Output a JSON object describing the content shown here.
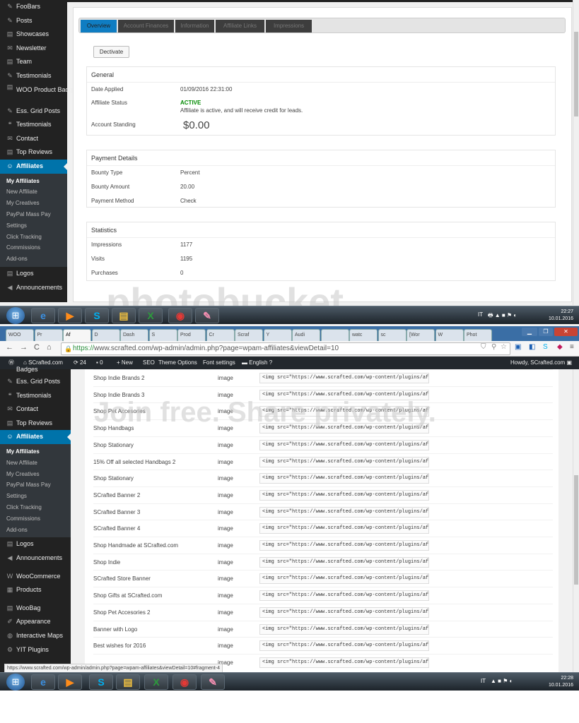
{
  "shot1": {
    "sidebar": [
      {
        "label": "FooBars",
        "icon": "pin-icon"
      },
      {
        "label": "Posts",
        "icon": "pin-icon"
      },
      {
        "label": "Showcases",
        "icon": "media-icon"
      },
      {
        "label": "Newsletter",
        "icon": "email-icon"
      },
      {
        "label": "Team",
        "icon": "media-icon"
      },
      {
        "label": "Testimonials",
        "icon": "pin-icon"
      },
      {
        "label": "WOO Product Badges",
        "icon": "media-icon",
        "two": true
      },
      {
        "label": "Ess. Grid Posts",
        "icon": "pin-icon"
      },
      {
        "label": "Testimonials",
        "icon": "quote-icon"
      },
      {
        "label": "Contact",
        "icon": "email-icon"
      },
      {
        "label": "Top Reviews",
        "icon": "media-icon"
      },
      {
        "label": "Affiliates",
        "icon": "users-icon",
        "active": true
      }
    ],
    "submenu": [
      "My Affiliates",
      "New Affiliate",
      "My Creatives",
      "PayPal Mass Pay",
      "Settings",
      "Click Tracking",
      "Commissions",
      "Add-ons"
    ],
    "sidebar_after": [
      {
        "label": "Logos",
        "icon": "media-icon"
      },
      {
        "label": "Announcements",
        "icon": "megaphone-icon"
      }
    ],
    "tabs": [
      "Overview",
      "Account Finances",
      "Information",
      "Affiliate Links",
      "Impressions"
    ],
    "deactivate_label": "Dectivate",
    "general": {
      "title": "General",
      "date_applied_label": "Date Applied",
      "date_applied": "01/09/2016 22:31:00",
      "status_label": "Affiliate Status",
      "status": "ACTIVE",
      "status_note": "Affiliate is active, and will receive credit for leads.",
      "standing_label": "Account Standing",
      "standing": "$0.00"
    },
    "payment": {
      "title": "Payment Details",
      "bounty_type_label": "Bounty Type",
      "bounty_type": "Percent",
      "bounty_amount_label": "Bounty Amount",
      "bounty_amount": "20.00",
      "method_label": "Payment Method",
      "method": "Check"
    },
    "stats": {
      "title": "Statistics",
      "impressions_label": "Impressions",
      "impressions": "1177",
      "visits_label": "Visits",
      "visits": "1195",
      "purchases_label": "Purchases",
      "purchases": "0"
    },
    "taskbar": {
      "lang": "IT",
      "time": "22:27",
      "date": "10.01.2016"
    },
    "watermark": "photobucket"
  },
  "shot2": {
    "browser_tabs": [
      "WOO",
      "Pr",
      "Af",
      "D",
      "Dash",
      "S",
      "Prod",
      "Cr",
      "Scraf",
      "Y",
      "Audi",
      "",
      "watc",
      "sc",
      "[Wor",
      "W",
      "Phot"
    ],
    "url": "https://www.scrafted.com/wp-admin/admin.php?page=wpam-affiliates&viewDetail=10",
    "url_scheme": "https://",
    "url_rest": "www.scrafted.com/wp-admin/admin.php?page=wpam-affiliates&viewDetail=10",
    "adminbar": {
      "site": "SCrafted.com",
      "updates": "24",
      "comments": "0",
      "new": "New",
      "seo": "SEO",
      "theme_options": "Theme Options",
      "font_settings": "Font settings",
      "language": "English",
      "howdy": "Howdy, SCrafted.com"
    },
    "sidebar_top_partial": "Badges",
    "sidebar": [
      {
        "label": "Ess. Grid Posts",
        "icon": "pin-icon"
      },
      {
        "label": "Testimonials",
        "icon": "quote-icon"
      },
      {
        "label": "Contact",
        "icon": "email-icon"
      },
      {
        "label": "Top Reviews",
        "icon": "media-icon"
      },
      {
        "label": "Affiliates",
        "icon": "users-icon",
        "active": true
      }
    ],
    "submenu": [
      "My Affiliates",
      "New Affiliate",
      "My Creatives",
      "PayPal Mass Pay",
      "Settings",
      "Click Tracking",
      "Commissions",
      "Add-ons"
    ],
    "sidebar_after": [
      {
        "label": "Logos",
        "icon": "media-icon"
      },
      {
        "label": "Announcements",
        "icon": "megaphone-icon"
      },
      {
        "label": "WooCommerce",
        "icon": "woo-icon"
      },
      {
        "label": "Products",
        "icon": "archive-icon"
      },
      {
        "label": "WooBag",
        "icon": "media-icon"
      },
      {
        "label": "Appearance",
        "icon": "brush-icon"
      },
      {
        "label": "Interactive Maps",
        "icon": "globe-icon"
      },
      {
        "label": "YIT Plugins",
        "icon": "gear-icon"
      }
    ],
    "creatives": [
      {
        "name": "Shop Indie Brands 2",
        "type": "image",
        "code": "<img src=\"https://www.scrafted.com/wp-content/plugins/affili"
      },
      {
        "name": "Shop Indie Brands 3",
        "type": "image",
        "code": "<img src=\"https://www.scrafted.com/wp-content/plugins/affili"
      },
      {
        "name": "Shop Pet Accesories",
        "type": "image",
        "code": "<img src=\"https://www.scrafted.com/wp-content/plugins/affili"
      },
      {
        "name": "Shop Handbags",
        "type": "image",
        "code": "<img src=\"https://www.scrafted.com/wp-content/plugins/affili"
      },
      {
        "name": "Shop Stationary",
        "type": "image",
        "code": "<img src=\"https://www.scrafted.com/wp-content/plugins/affili"
      },
      {
        "name": "15% Off all selected Handbags 2",
        "type": "image",
        "code": "<img src=\"https://www.scrafted.com/wp-content/plugins/affili"
      },
      {
        "name": "Shop Stationary",
        "type": "image",
        "code": "<img src=\"https://www.scrafted.com/wp-content/plugins/affili"
      },
      {
        "name": "SCrafted Banner 2",
        "type": "image",
        "code": "<img src=\"https://www.scrafted.com/wp-content/plugins/affili"
      },
      {
        "name": "SCrafted Banner 3",
        "type": "image",
        "code": "<img src=\"https://www.scrafted.com/wp-content/plugins/affili"
      },
      {
        "name": "SCrafted Banner 4",
        "type": "image",
        "code": "<img src=\"https://www.scrafted.com/wp-content/plugins/affili"
      },
      {
        "name": "Shop Handmade at SCrafted.com",
        "type": "image",
        "code": "<img src=\"https://www.scrafted.com/wp-content/plugins/affili"
      },
      {
        "name": "Shop Indie",
        "type": "image",
        "code": "<img src=\"https://www.scrafted.com/wp-content/plugins/affili"
      },
      {
        "name": "SCrafted Store Banner",
        "type": "image",
        "code": "<img src=\"https://www.scrafted.com/wp-content/plugins/affili"
      },
      {
        "name": "Shop Gifts at SCrafted.com",
        "type": "image",
        "code": "<img src=\"https://www.scrafted.com/wp-content/plugins/affili"
      },
      {
        "name": "Shop Pet Accesories 2",
        "type": "image",
        "code": "<img src=\"https://www.scrafted.com/wp-content/plugins/affili"
      },
      {
        "name": "Banner with Logo",
        "type": "image",
        "code": "<img src=\"https://www.scrafted.com/wp-content/plugins/affili"
      },
      {
        "name": "Best wishes for 2016",
        "type": "image",
        "code": "<img src=\"https://www.scrafted.com/wp-content/plugins/affili"
      },
      {
        "name": "",
        "type": "image",
        "code": "<img src=\"https://www.scrafted.com/wp-content/plugins/affili"
      }
    ],
    "status_url": "https://www.scrafted.com/wp-admin/admin.php?page=wpam-affiliates&viewDetail=10#fragment-4",
    "taskbar": {
      "lang": "IT",
      "time": "22:28",
      "date": "10.01.2016"
    },
    "watermark": "Join free. Share privately."
  },
  "colors": {
    "wp_dark": "#222222",
    "wp_blue": "#0073aa",
    "active_green": "#008a00"
  }
}
